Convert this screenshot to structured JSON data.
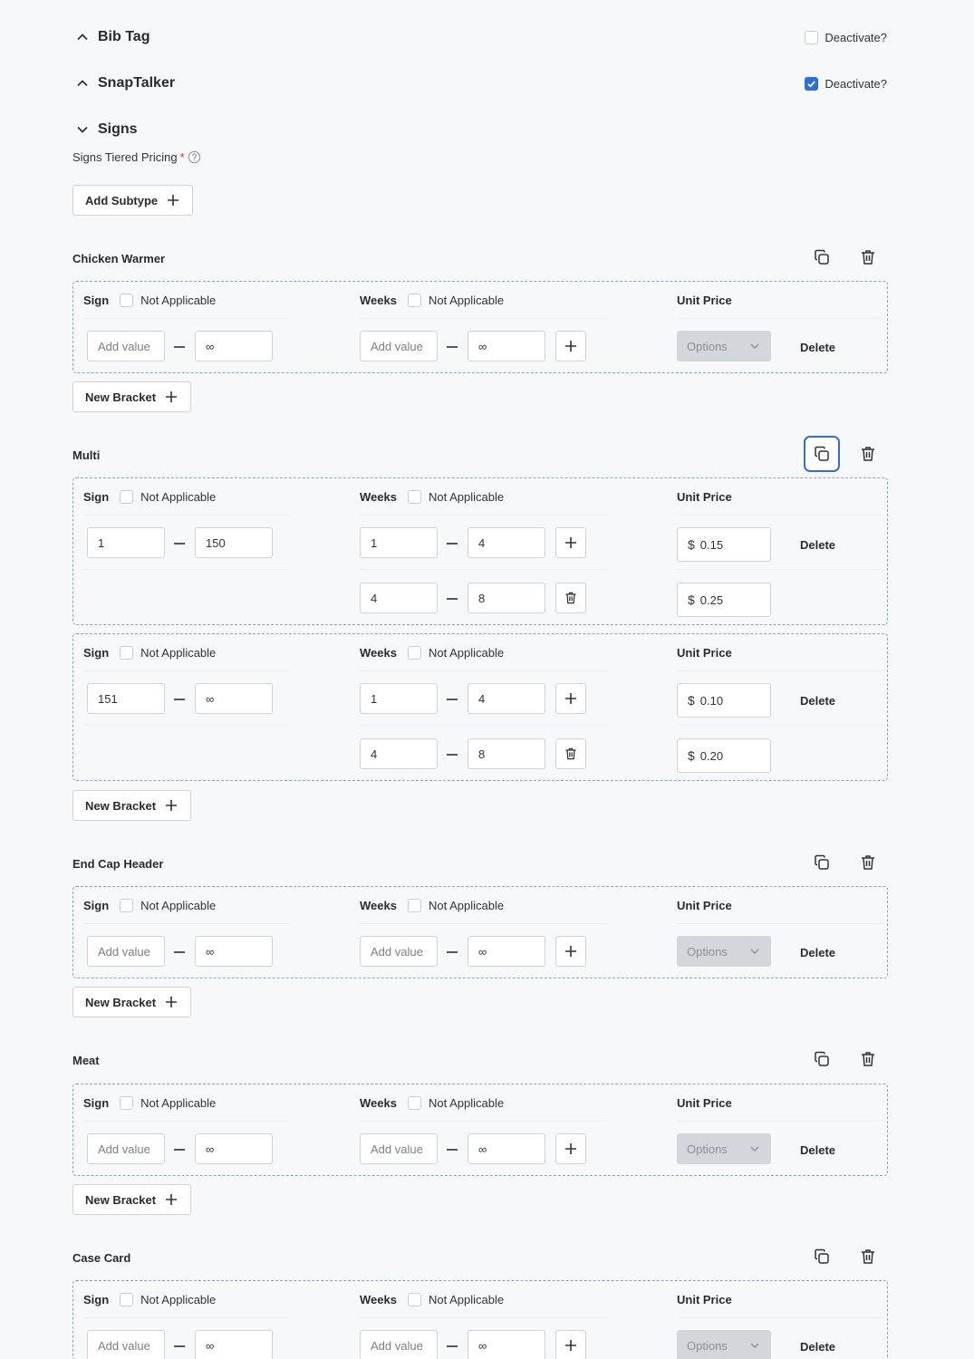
{
  "sections": [
    {
      "title": "Bib Tag",
      "deactivate_label": "Deactivate?",
      "deactivate_checked": false
    },
    {
      "title": "SnapTalker",
      "deactivate_label": "Deactivate?",
      "deactivate_checked": true
    },
    {
      "title": "Signs"
    }
  ],
  "signs": {
    "tiered_pricing_label": "Signs Tiered Pricing",
    "required_mark": "*",
    "add_subtype_label": "Add Subtype"
  },
  "column_labels": {
    "sign": "Sign",
    "weeks": "Weeks",
    "unit_price": "Unit Price",
    "not_applicable": "Not Applicable",
    "delete": "Delete",
    "options": "Options",
    "new_bracket": "New Bracket",
    "currency": "$",
    "add_value": "Add value",
    "infinity": "∞"
  },
  "groups": [
    {
      "name": "Chicken Warmer"
    },
    {
      "name": "Multi",
      "brackets": [
        {
          "sign_min": "1",
          "sign_max": "150",
          "rows": [
            {
              "weeks_min": "1",
              "weeks_max": "4",
              "price": "0.15"
            },
            {
              "weeks_min": "4",
              "weeks_max": "8",
              "price": "0.25"
            }
          ]
        },
        {
          "sign_min": "151",
          "sign_max": "∞",
          "rows": [
            {
              "weeks_min": "1",
              "weeks_max": "4",
              "price": "0.10"
            },
            {
              "weeks_min": "4",
              "weeks_max": "8",
              "price": "0.20"
            }
          ]
        }
      ]
    },
    {
      "name": "End Cap Header"
    },
    {
      "name": "Meat"
    },
    {
      "name": "Case Card"
    }
  ],
  "icons": {
    "chevron_up": "chevron-up-icon",
    "chevron_down": "chevron-down-icon",
    "help": "help-circle-icon",
    "plus": "plus-icon",
    "copy": "copy-icon",
    "trash": "trash-icon",
    "check": "check-icon"
  },
  "colors": {
    "accent": "#2f6fd9",
    "dashed_border": "#7fa7e6",
    "background": "#f7f8fa",
    "disabled_select": "#d3d7dc"
  }
}
